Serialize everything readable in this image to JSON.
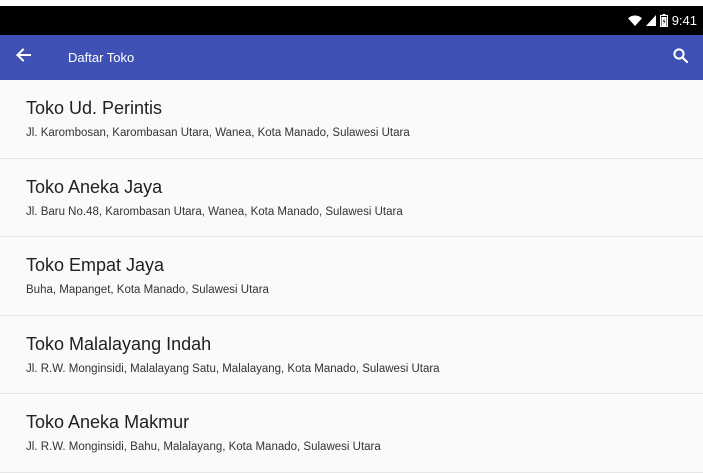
{
  "status_bar": {
    "time": "9:41",
    "icons": [
      "wifi-icon",
      "cell-signal-icon",
      "battery-icon"
    ]
  },
  "app_bar": {
    "title": "Daftar Toko",
    "back_icon": "arrow-back-icon",
    "search_icon": "search-icon"
  },
  "stores": [
    {
      "name": "Toko Ud. Perintis",
      "address": "Jl. Karombosan, Karombasan Utara, Wanea, Kota Manado, Sulawesi Utara"
    },
    {
      "name": "Toko Aneka Jaya",
      "address": "Jl. Baru No.48, Karombasan Utara, Wanea, Kota Manado, Sulawesi Utara"
    },
    {
      "name": "Toko Empat Jaya",
      "address": "Buha, Mapanget, Kota Manado, Sulawesi Utara"
    },
    {
      "name": "Toko Malalayang Indah",
      "address": "Jl. R.W. Monginsidi, Malalayang Satu, Malalayang, Kota Manado, Sulawesi Utara"
    },
    {
      "name": "Toko Aneka Makmur",
      "address": "Jl. R.W. Monginsidi, Bahu, Malalayang, Kota Manado, Sulawesi Utara"
    }
  ],
  "colors": {
    "app_bar": "#3f51b5",
    "status_bar": "#000000",
    "background": "#fafafa",
    "divider": "#e6e6e6"
  }
}
